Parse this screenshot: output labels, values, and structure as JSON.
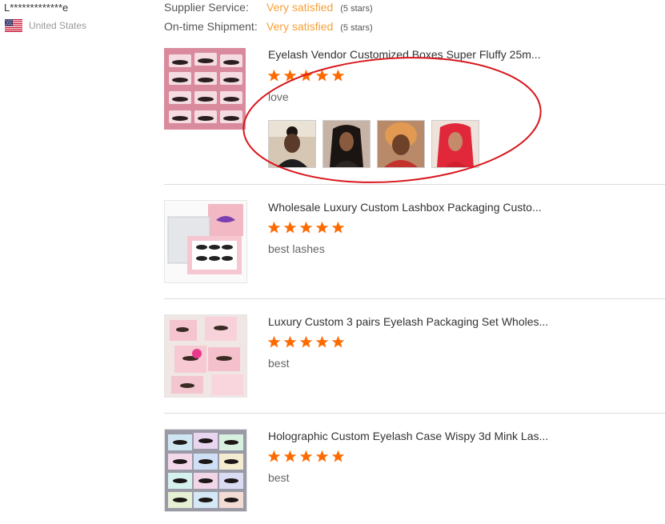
{
  "reviewer": {
    "name": "L*************e",
    "country": "United States"
  },
  "ratings": [
    {
      "label": "Supplier Service:",
      "value": "Very satisfied",
      "stars_note": "(5 stars)"
    },
    {
      "label": "On-time Shipment:",
      "value": "Very satisfied",
      "stars_note": "(5 stars)"
    }
  ],
  "products": [
    {
      "title": "Eyelash Vendor Customized Boxes Super Fluffy 25m...",
      "rating": 5,
      "comment": "love",
      "review_image_count": 4
    },
    {
      "title": "Wholesale Luxury Custom Lashbox Packaging Custo...",
      "rating": 5,
      "comment": "best lashes"
    },
    {
      "title": "Luxury Custom 3 pairs Eyelash Packaging Set Wholes...",
      "rating": 5,
      "comment": "best"
    },
    {
      "title": "Holographic Custom Eyelash Case Wispy 3d Mink Las...",
      "rating": 5,
      "comment": "best"
    }
  ],
  "colors": {
    "accent": "#f7a13a",
    "star": "#ff6a00",
    "annotation_circle": "#d9161c"
  },
  "icons": [
    "us-flag-icon",
    "star-icon"
  ]
}
